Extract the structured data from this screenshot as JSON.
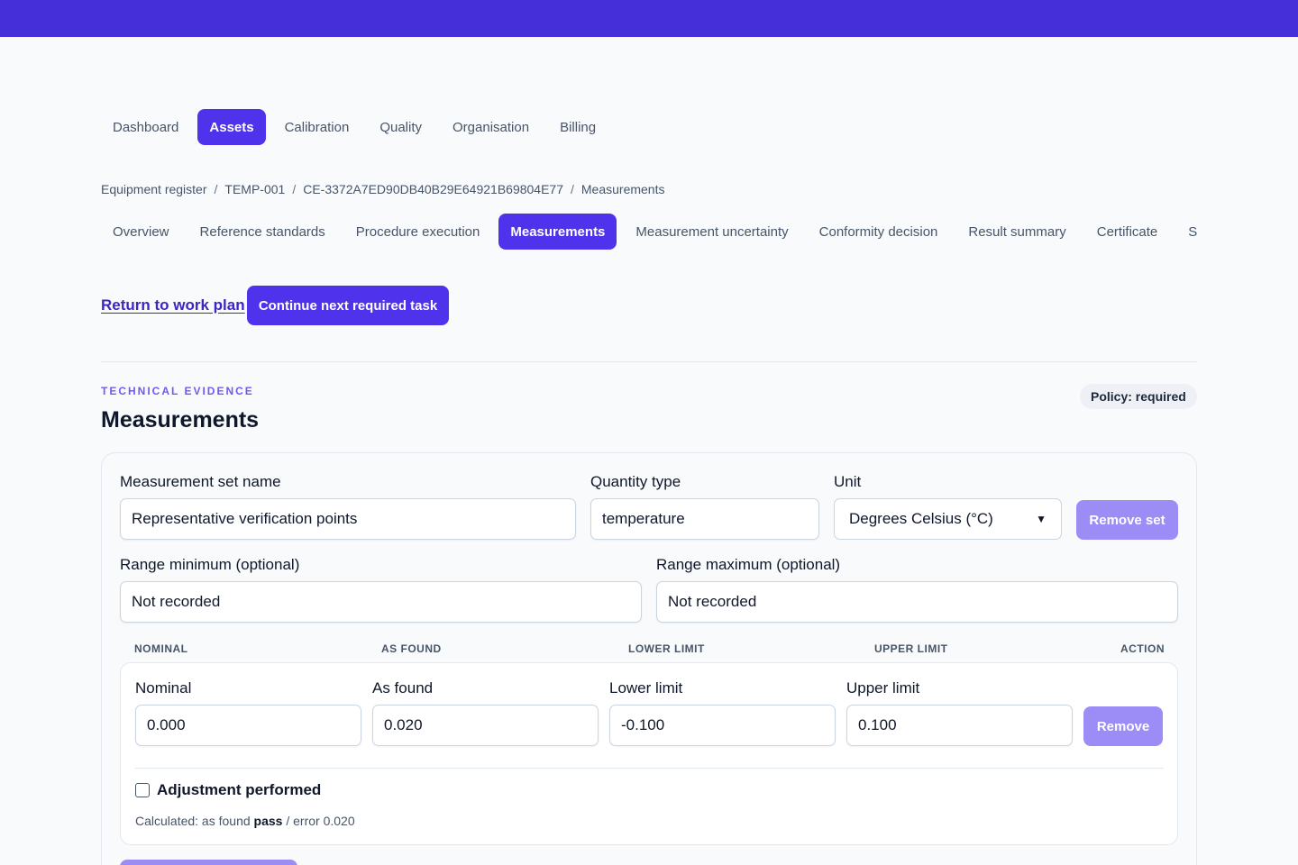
{
  "main_nav": [
    "Dashboard",
    "Assets",
    "Calibration",
    "Quality",
    "Organisation",
    "Billing"
  ],
  "main_nav_active": "Assets",
  "breadcrumb": [
    "Equipment register",
    "TEMP-001",
    "CE-3372A7ED90DB40B29E64921B69804E77",
    "Measurements"
  ],
  "breadcrumb_separator": "/",
  "sub_nav": [
    "Overview",
    "Reference standards",
    "Procedure execution",
    "Measurements",
    "Measurement uncertainty",
    "Conformity decision",
    "Result summary",
    "Certificate",
    "S"
  ],
  "sub_nav_active": "Measurements",
  "actions": {
    "return_link": "Return to work plan",
    "continue_button": "Continue next required task"
  },
  "section": {
    "eyebrow": "TECHNICAL EVIDENCE",
    "title": "Measurements",
    "policy_badge": "Policy: required"
  },
  "measurement_set": {
    "name_label": "Measurement set name",
    "name_value": "Representative verification points",
    "quantity_label": "Quantity type",
    "quantity_value": "temperature",
    "unit_label": "Unit",
    "unit_value": "Degrees Celsius (°C)",
    "remove_set_button": "Remove set",
    "range_min_label": "Range minimum (optional)",
    "range_min_value": "Not recorded",
    "range_max_label": "Range maximum (optional)",
    "range_max_value": "Not recorded"
  },
  "table": {
    "columns": [
      "NOMINAL",
      "AS FOUND",
      "LOWER LIMIT",
      "UPPER LIMIT",
      "ACTION"
    ],
    "row": {
      "nominal_label": "Nominal",
      "nominal_value": "0.000",
      "as_found_label": "As found",
      "as_found_value": "0.020",
      "lower_label": "Lower limit",
      "lower_value": "-0.100",
      "upper_label": "Upper limit",
      "upper_value": "0.100",
      "remove_button": "Remove",
      "adjustment_label": "Adjustment performed",
      "adjustment_checked": false,
      "calc_prefix": "Calculated: as found",
      "calc_result": "pass",
      "calc_suffix": "/ error 0.020"
    }
  },
  "colors": {
    "brand_bar": "#452fd9",
    "primary": "#4f32ec",
    "primary_disabled": "#9c8cf6",
    "link": "#3b26c4",
    "eyebrow": "#6d5cf0"
  },
  "icons": {
    "select_arrow": "chevron-down-icon"
  }
}
